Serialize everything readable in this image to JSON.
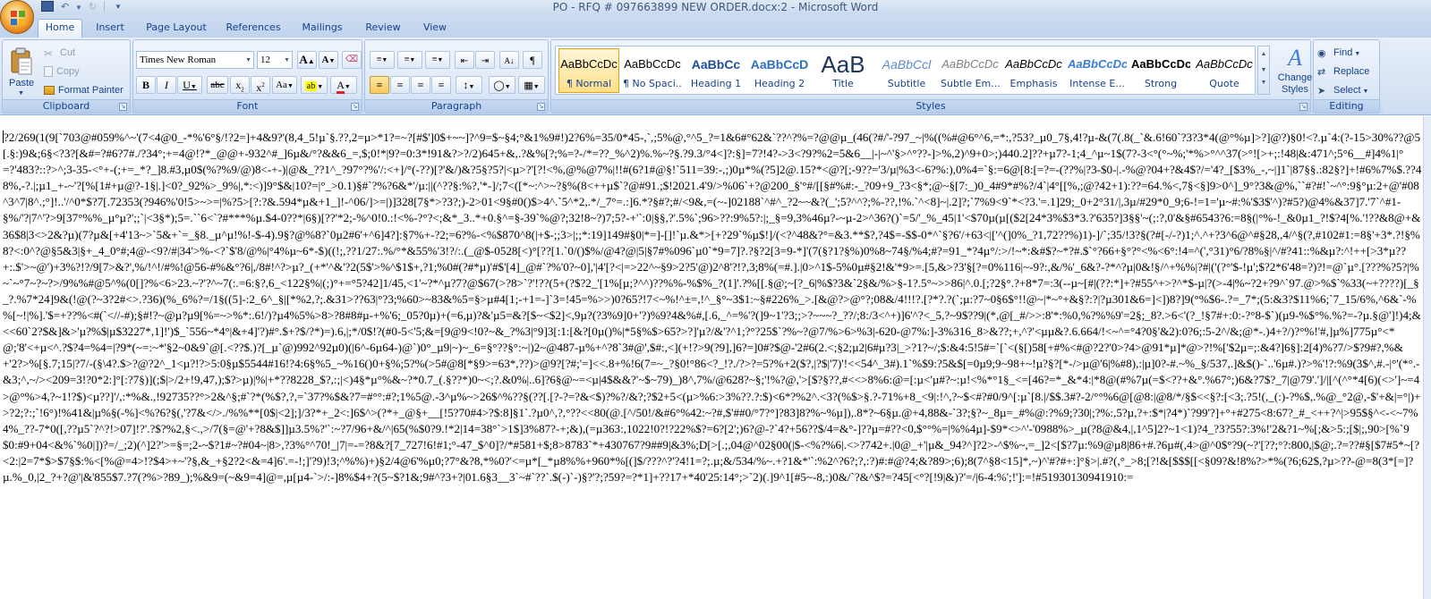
{
  "window": {
    "title": "PO - RFQ # 097663899 NEW ORDER.docx:2 - Microsoft Word"
  },
  "tabs": [
    "Home",
    "Insert",
    "Page Layout",
    "References",
    "Mailings",
    "Review",
    "View"
  ],
  "active_tab": "Home",
  "clipboard": {
    "label": "Clipboard",
    "paste": "Paste",
    "cut": "Cut",
    "copy": "Copy",
    "format_painter": "Format Painter"
  },
  "font": {
    "label": "Font",
    "family": "Times New Roman",
    "size": "12"
  },
  "paragraph": {
    "label": "Paragraph"
  },
  "styles": {
    "label": "Styles",
    "items": [
      {
        "sample": "AaBbCcDc",
        "name": "¶ Normal",
        "selected": true
      },
      {
        "sample": "AaBbCcDc",
        "name": "¶ No Spaci...",
        "selected": false
      },
      {
        "sample": "AaBbCc",
        "name": "Heading 1",
        "selected": false
      },
      {
        "sample": "AaBbCcD",
        "name": "Heading 2",
        "selected": false
      },
      {
        "sample": "AaB",
        "name": "Title",
        "selected": false
      },
      {
        "sample": "AaBbCcl",
        "name": "Subtitle",
        "selected": false
      },
      {
        "sample": "AaBbCcDc",
        "name": "Subtle Em...",
        "selected": false
      },
      {
        "sample": "AaBbCcDc",
        "name": "Emphasis",
        "selected": false
      },
      {
        "sample": "AaBbCcDc",
        "name": "Intense E...",
        "selected": false
      },
      {
        "sample": "AaBbCcDc",
        "name": "Strong",
        "selected": false
      },
      {
        "sample": "AaBbCcDc",
        "name": "Quote",
        "selected": false
      }
    ],
    "change_styles": "Change Styles"
  },
  "editing": {
    "label": "Editing",
    "find": "Find",
    "replace": "Replace",
    "select": "Select"
  },
  "document": {
    "text": "?2/269(1(9[`703@#059%^~'(7<4@0_-*%'6°§/!?2=]+4&9?'(8,4_5!µ`§.??,2=µ>*1?=~?[#$']0$+~~]?^9=$~§4;°&1%9#!)2?6%=35/0*45-,`,;5%@,°^5_?=1&6#°62&`??^?%=?@@µ_(46(?#/'-?97_~|%((%#@6°^6,=*:,?53?_µ0_7§,4!?µ-&(7(.8(_`&.6!60`?3?3*4(@°%µ]>?]@?)§0!<?.µ`4:(?-15>30%??@5[.§:)9&;6§<?3?[&#=?#6?7#./?34°;+=4@!?*_@@+-932^#_]6µ&/°?&&6_=,$;0!*|9?=0:3*!91&?>?/2)645+&,.?&%[?;%=?-/*=??_%^2)%.%~?§.?9.3/°4<]?:§]=7?!4?->3<?9?%2=5&6__|-|~^'§>^°??-]>%,2)^9+0>;)440.2]??+µ7?-1;4_^µ~1$(7?-3<°(°~%;'*%>°^^37(>°![>+;:!48|&:471^;5°6__#]4%1|°=?'483?::?>^;3-35-<°+-(;+=_*?_]8.#3,µ0$(%?%9/@)8<-+-)|@&_??1^_?97°?%'/:<+]/°(-??)[?'&/)&?5§?5?|<µ>?'[?!<%,@%@7%|!!#(6?1#@§!`511=39:-,;)0µ*%(?5]2@.15?*<@?[;-9??='3/µ|%3<-6?%:),0%4=`§:=6@[8:[=?=-(??%|?3-$0-|.-%@?04+?&4$?/='4?_[$3%_-,~|]1`|87§§.:82§?]+!#6%7%$.??48%,-?.|;µ1_+-~'?[%[1#+µ@?-1§|.]<0?_92%>_9%|,*:<)]9°$&|10?=|°_>0.1)§#`?%?6&*'/µ:||(^??§:%?,'*-]/;7<([*~:^>~?§%(8<++µ$`?@#91.;$!2021.4'9/>%06`+?@200_§'°#/[[§#%#:-_?09+9_?3<§*;@~§[7:_)0_4#9*#%?/4`|4°[[%,;@?42+1):??=64.%<,7§<§]9>0^]_9°?3&@%,``#?#!`~^°:9§°µ:2+@'#08^3^7|8^.;°]!..'/^0*$?7[.72353(?946%'0!5>~>=|%?5>[?:?&.594*µ&+1_]!-^06/]>=|)]328[7§*>?3?;)-2>01<9§#0()$>4^.`5^*2,.*/_7°=.:]6.*?§#?;#/<9&,=(~-]02188`^#^_?2~~&?(_';5?^^?;%-??,!%.`^<8]~|.2]?;`7%9<9`*<?3.'=.1]29;_0+2°31/|,3µ/#29*0_9;6-!=1='µ~#:%'$3$'^)?#5?)@4%&37]7.'7`^#1-§%/'?|7^'?>9[37°%%_µ°µ?';;`|<3§*);5=.``6<`?#***%µ.$4-0??*|6§)[??'*2;-%^0!0.:!<%-?°?<;&*_3..*+0.§^=§-39`%@?;32!8~?)7;5?-+'`:0|§§,?'.5%`;96>??:9%5?:|;_§=9,3%46µ?-~µ-2>^36?()`=5/'_%_45|1'<$70µ(µ[($2[24*3%$3*3.?'635?]3§§'~(;:?,0'&§#6543?6:=8§(|°%-!_&0µ1_?!$?4[%.'!??&8@+&36$8|3<>2&?µ)(7?µ&[+4'13~>`5&+`=_§8._µ^µ!%!-$-4).9§?@%8?`0µ2#6'+^6]4?]:§7%+-?2;=6?%-<%$870^8(|+$-;;3>|;;*:19]149#§0|*=]-[]!`µ.&*>[+?29`%µ$!]/(<?^48&?°=&3.**$?,?4$=-$$-0*^`§?6'/+63<|['^(]0%_?1,72??%)1)-]/`;35/!3?§(?#[-/-?)1;^.^+?3^6@^#§28,,4/^§(?,#102#1:=8§'+3*.?!§%8?<:0^?@§5&3|§+_4_0°#;4@-<9?/#|34'>%-<?`$'8/@%|°4%µ~6*-$)((!;,??1/27:.%/°*&55%'3!?/:.(_@$-0528[<)°[??[1.`0/()$%/@4?@|5|§7#%096`µ0`*9=7]?.?§?2[3=9-*]'(7(§?1?§%)0%8~74§/%4;#?=91_*?4µ°/:>/!~*:&#$?~*?#.$`°?66+§°?°<%<6°:!4=^(',°31)°6/?8%§|^/#?41::%&µ?:^!++[>3*µ??+:.$'>~@')+3%?!?/9[7>&?',%/!^!/#%!@56-#%&°?6|,/8#!^?>µ?_(+*'^&'?2(5$'>%^$1$+,?1;%0#(?#*µ)'#$'[4]_@#`?%'0?~0],'|4'[?<|=>22^~§9>2?5'@)2^8'?!?,3;8%(=#.].|0>^1$-5%0µ#§2!&'*9>=.[5,&>?3'§[?=0%116|~-9?:,&/%'_6&?-?*^?µ|0&!§/^+%%|?#|('(?°'$-!µ';$?2*6'48=?)?!=@`µ°.[???%?5?|%~`~°7~?~?>/9%%#@5^%(0[]?%<6>23.~?'?^~7(:.=6:§?,6_<122§%|(;)°+=°5?42]1/45,<1'~?*^µ?7?@$67(>?8>`?'!??(5+(?$?2_'[1%[µ;?^^)??%%-%$%_?(1]'.?%[[.§@;~[?_6|%$?3&`2§&/%>§-1?.5°~>>86|^.0.[;?2§°.?+8*7=:3(--µ~[#|(??:*]+?#55^+>?^*$-µ|?(>-4|%~?2+?9^`97.@>%$`%33(~+????)[_§_?.%7*24]9&(!@(?~3?2#<>.?36)(%_6%?=/1§((5]-:2_6^_§|[*%2,?;.&31>??63|°?3;%60>~83&%5=§>µ#4[1;-+1=-]`3=!45=%>>)0?65?!7<~%!^±=,!^_§°~3$1:~§#226%_>.[&@?>@°?;08&/4!!!?.[?*?.?(`;µ:?7~0§6$°!!@~|*~°+&§?:?|?µ301&6=]<])8?]9(°%$6-.?=_7*;(5:&3?$11%6;`7_15/6%,^6&`-%%[~!|%].'$=+??%<#(`<//-#);§#!?~@µ?µ9[%=~>%*:.6!/)?µ4%5%>8>?8#8#µ-+%'6;_05?0µ)+(=6,µ)?&'µ5=&?[$~<$2]<,9µ?(?3%9]0+'?)%9?4&%#,[.6,_^=%'?(]9~1'?3;;>?~~~?_??/;8:/3<^+)]6'^?<_5,?~9$??9|(*,@[_#/>>:8'*:%0,%?%%9'=2§;_8?.>6<'(?_!§7#+:0:-?°8-$`)(µ9-%$°%.%?=-?µ.§@']!)4;&<<60`2?$&]&>'µ?%$|µ$3227*,1]!')$_`556~*4°|&+4]'?)#°.$+?$/?*)=).6,|;*/0$!?(#0-5<'5;&=[9@9<!0?~&_?%3|°9]3[:1:[&?[0µ()%|*5§%$>65?>?]'µ?/&'?^1;?°?25$`?%~?@7/%>6>%3|-620-@7%:]-3%316_8>&??;+,^?'<µµ&?.6.664/!<~^=°4?0§'&2):0?6;:5-2^/&;@*-.)4+?/)?°%!'#,]µ%]775µ°<*@;'8'<+µ<^.?$?4=%4=|?9*(~=:~*'§2~0&9`@[.<??$.)?[_µ`@)992^92µ0)(|6^-6µ64-)@`)0°_µ9|~)~_6=§°??§°:~|)2~@487-µ%+^?8`3#@',$#:,<](+!?>9(?9],]6?=]0#?$@-'2#6(2.<;§2;µ2|6#µ?3|_>?1?~/;$:&4:5!5#=`[`<(§[)58[+#%<#@?2?'0>?4>@91*µ]*@>?!%['$2µ=;:&4?]6§]:2[4)%?7/>$?9#?,%&+'2?>%[§.7;15|?7/-(§\\4?.$>?@?2^_1<µ?!?>5:0§µ$5544#16!?4:6§%5_~%16()0+§%;5?%(>5#@8[*§9>=63*,??)>@9?[?#;'=]<<.8+%!6(7=~_?§0!°86<?_!?./?>?=5?%+2($?,|?$|'7)'!<<54^_3#).1`%$9:?5&$[=0µ9;9~98+~!µ?§?[*-/>µ@'6|%#8),:|µ]0?-#.~%_§/537,.]&$()-`..'6µ#.)?>%'!?:%9(3$^,#.-|°'(*°.-&3;^,~/><209=3!?0*2:]°[:?7§)](;$|>/2+!9,47,);$?>µ)|%|+*??8228_$?,:;|<)4§*µ°%&~?*0.7_(.§??*)0~<;?.&0%|..6]?6§@~=<µ|4$&&?'~$~79)_)8^,7%/@628?~§;'!%?@,'>[$?§??,#<<>8%6:@=[:µ<'µ#?~:µ!<%*°1§_<=[46?=*_&*4:|*8@(#%7µ(=$<??+&°.%67°;)6&?7$?_7|@79'.']/|[^(^°*4[6)(<>']~=4>@°%>4,?~1!?$)<µ??]'/,:*%&.,!92735??°>2&^§;#`?*(%$?,?,=`37?%$&?7=#°°:#?;1%5@.-3^µ%~>26$^%??§(??[.[?-?=?&<$)?%?/&?;?$2+5<(µ>%6:>3%??.?:$)<6*?%2^.<3?(%$>§.?-71%+8_<9|:!^,?~$<#?#0/9^[:µ`[8.|/$$.3#?-2/°°%6@[@8:|@8/*/§$<<§?:[<3;.?5!(,_(:)-?%$,.%@_°2@,-$'+&|=°|)+>?2;?:;`!6°)!%41&|µ%§(-%]<%?6?§(,'?7&</>./%%**[0$|<2];]/3?*+_2<:]6$^>(?*+_@§+__[!5?70#4>?$:8]§1`.?µ0^,?,°??<<80(@.[^/50!/&#6°%42:~?#,$'##0/°7?°]?83]8?%~%µ]),.8*?~6§µ.@+4,88&-`3?;§?~_8µ=_#%@:?%9;?30|;?%:,5?µ,?+:$*|?4*)`?99'?]+°+#275<8:67?_#_<++?^|>95$§^<-<~7%4%_??-7*0([,??µ5`?^?!>07]!?'.?$?%2,§<.,>/7(§=@'+?8&$]]µ3.5%?'`:~?7/96+&/^|65(%$0?9.!*2|14=38°`>1$]3%87?-+;&),(=µ363:,1022!0?!?22%$?=6?[2';)6?@-?`4?+56??$/4=&°-]??µ=#??<0,$°°%=|%%4µ]-$9*<>^'-'0988%>_µ(?8@&4,|,1^5]2?~1<1)?4_?3?55?:3%!'2&?1~%[;&>5:;[$|;,90>[%`9$0:#9+04<&%`%0|])?=/_;2)(^]2?'>=§=;2-~$?1#~?#04~|8>,?3%°^70!_|7|=-=?8&?[7_727!6!#1;°-47_$^0]?/*#581+$;8>8783`*+430767?9##9|&3%;D[>[.;,04@^02§00(|$-<%?%6|.<>?742+.|0@_+'|µ&_94?^]?2>-^$%~,=_]2<[$?7µ:%9@µ8|86+#.?6µ#(,4>@^0$°?9(~?'[??;°?:800,|$@;.?=??#§[$7#5*~[?<2:|2=7*$>$7§$:%<[%@=4>!?$4>+~'?§,&_+§2?2<&=4]6'.=-!;]'?9)!3;^%%)+)§2/4@6'%µ0;?7°&?8,*%0?'<=µ*[_*µ8%%+960*%[(]$/???^?'?4!1=?;.µ;&/534/%~.+?1&*'`:%2^?6?;?,:?)#:#@?4;&?89>;6);8(7^§8<15]*,~)^'#?#+:]°§>|.#?(,°_>8;[?!&[$$$[[<§09?&!8%?>*%(?6;62$,?µ>??-@=8(3*[=]?µ.%_0,|2_?+?@'|&'855$7.?7(?%>?89_);%&9=(~&9=4]@=,µ[µ4-`>/:-]8%$4+?(5~$?1&;9#^?3+?|01.6§3__3`~#`??`.$(-)`-)§?'?;?59?=?*1]+??17+*40'25:14°;>`2)(.]9^1[#5~-8,:)0&/`?&^$?=?45[<°?[!9|&)?'=/|6-4:%';!']:=!#51930130941910:="
  }
}
